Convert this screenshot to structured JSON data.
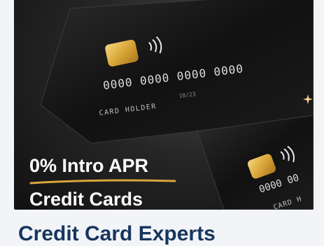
{
  "hero": {
    "card_top": {
      "number": "0000 0000 0000 0000",
      "expiry": "10/23",
      "holder": "CARD HOLDER"
    },
    "card_bottom": {
      "number": "0000 00",
      "holder": "CARD H"
    }
  },
  "promo": {
    "line1": "0% Intro APR",
    "line2": "Credit Cards"
  },
  "headline": "Credit Card Experts",
  "colors": {
    "headline": "#17365e",
    "accent_gold": "#d9a63a",
    "card_dark": "#141414"
  }
}
